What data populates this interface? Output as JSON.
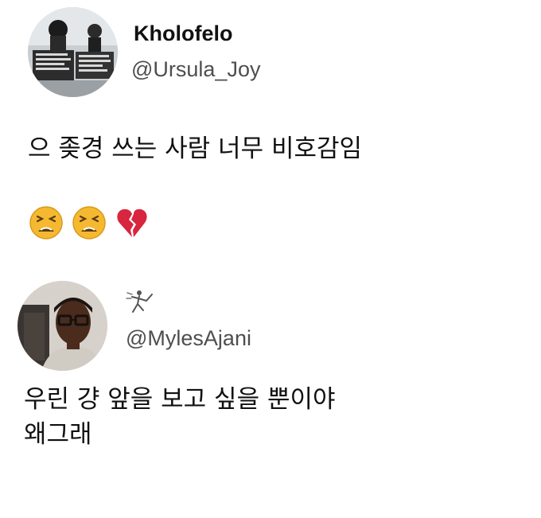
{
  "tweets": [
    {
      "display_name": "Kholofelo",
      "handle": "@Ursula_Joy",
      "text": "으 좆경 쓰는 사람 너무 비호감임",
      "emojis": [
        "tired-face-emoji",
        "tired-face-emoji",
        "broken-heart-emoji"
      ]
    },
    {
      "display_name": "",
      "handle": "@MylesAjani",
      "name_icon": "running-figure-icon",
      "text": "우린 걍 앞을 보고 싶을 뿐이야\n왜그래"
    }
  ],
  "colors": {
    "background": "#ffffff",
    "text": "#111111",
    "handle": "#4e4e4e",
    "emoji_face": "#f5b931",
    "broken_heart": "#d7263d"
  }
}
